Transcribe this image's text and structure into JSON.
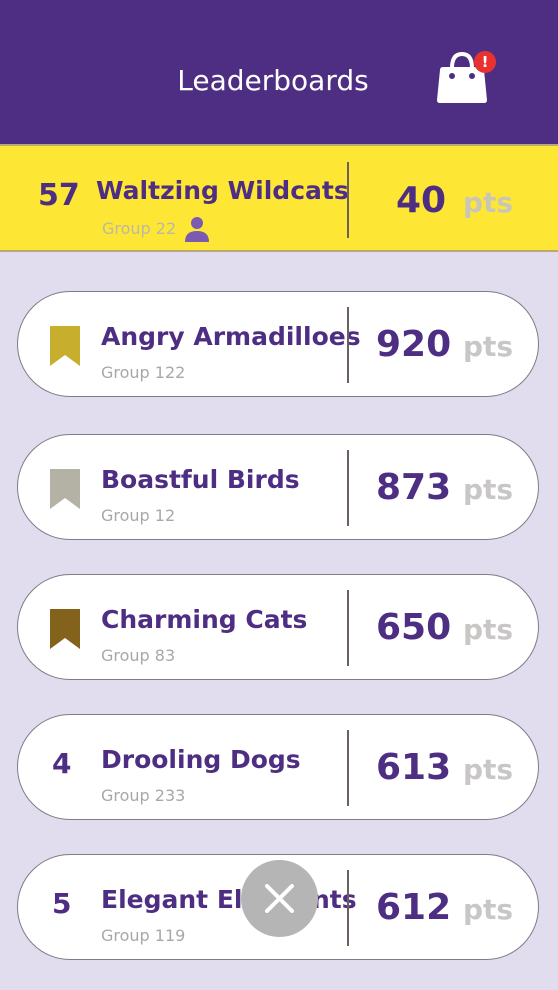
{
  "header": {
    "title": "Leaderboards",
    "cart_badge": "!"
  },
  "my_team": {
    "rank": "57",
    "name": "Waltzing Wildcats",
    "group": "Group 22",
    "score": "40",
    "pts_label": "pts"
  },
  "rows": [
    {
      "ribbon": "gold-ribbon",
      "ribbon_color": "#c7ae2d",
      "rank": "",
      "name": "Angry Armadilloes",
      "group": "Group 122",
      "score": "920",
      "pts_label": "pts"
    },
    {
      "ribbon": "silver-ribbon",
      "ribbon_color": "#b4b2a4",
      "rank": "",
      "name": "Boastful Birds",
      "group": "Group 12",
      "score": "873",
      "pts_label": "pts"
    },
    {
      "ribbon": "bronze-ribbon",
      "ribbon_color": "#83621c",
      "rank": "",
      "name": "Charming Cats",
      "group": "Group 83",
      "score": "650",
      "pts_label": "pts"
    },
    {
      "ribbon": "",
      "rank": "4",
      "name": "Drooling Dogs",
      "group": "Group 233",
      "score": "613",
      "pts_label": "pts"
    },
    {
      "ribbon": "",
      "rank": "5",
      "name": "Elegant Elephants",
      "group": "Group 119",
      "score": "612",
      "pts_label": "pts"
    }
  ],
  "colors": {
    "primary": "#4e2e83",
    "highlight": "#fde734",
    "background": "#e1ddee"
  }
}
